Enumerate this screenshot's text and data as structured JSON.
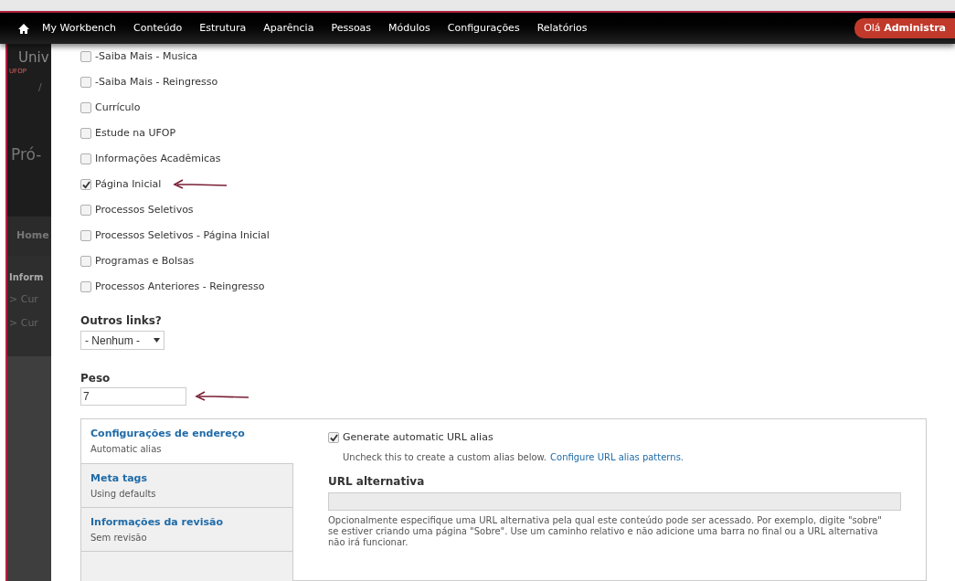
{
  "toolbar": {
    "items": [
      "My Workbench",
      "Conteúdo",
      "Estrutura",
      "Aparência",
      "Pessoas",
      "Módulos",
      "Configurações",
      "Relatórios"
    ],
    "greeting": "Olá",
    "user": "Administra"
  },
  "background_page": {
    "site_name": "Univ",
    "logo_text": "UFOP",
    "breadcrumb": "/",
    "title": "Pró-",
    "menu_item": "Home",
    "section_title": "Inform",
    "links": [
      "> Cur",
      "> Cur"
    ]
  },
  "checkboxes": [
    {
      "label": "-Saiba Mais - Musica",
      "checked": false,
      "annotated": false
    },
    {
      "label": "-Saiba Mais - Reingresso",
      "checked": false,
      "annotated": false
    },
    {
      "label": "Currículo",
      "checked": false,
      "annotated": false
    },
    {
      "label": "Estude na UFOP",
      "checked": false,
      "annotated": false
    },
    {
      "label": "Informações Acadêmicas",
      "checked": false,
      "annotated": false
    },
    {
      "label": "Página Inicial",
      "checked": true,
      "annotated": true
    },
    {
      "label": "Processos Seletivos",
      "checked": false,
      "annotated": false
    },
    {
      "label": "Processos Seletivos - Página Inicial",
      "checked": false,
      "annotated": false
    },
    {
      "label": "Programas e Bolsas",
      "checked": false,
      "annotated": false
    },
    {
      "label": "Processos Anteriores - Reingresso",
      "checked": false,
      "annotated": false
    }
  ],
  "outros_links": {
    "label": "Outros links?",
    "value": "- Nenhum -"
  },
  "peso": {
    "label": "Peso",
    "value": "7",
    "annotated": true
  },
  "vertical_tabs": [
    {
      "title": "Configurações de endereço",
      "summary": "Automatic alias",
      "selected": true
    },
    {
      "title": "Meta tags",
      "summary": "Using defaults",
      "selected": false
    },
    {
      "title": "Informações da revisão",
      "summary": "Sem revisão",
      "selected": false
    },
    {
      "selected": false
    }
  ],
  "url_settings": {
    "auto_alias": {
      "label": "Generate automatic URL alias",
      "checked": true
    },
    "auto_alias_help": "Uncheck this to create a custom alias below.",
    "help_link": "Configure URL alias patterns.",
    "alias_label": "URL alternativa",
    "alias_disabled": true,
    "alias_description": "Opcionalmente especifique uma URL alternativa pela qual este conteúdo pode ser acessado. Por exemplo, digite \"sobre\" se estiver criando uma página \"Sobre\". Use um caminho relativo e não adicione uma barra no final ou a URL alternativa não irá funcionar."
  }
}
